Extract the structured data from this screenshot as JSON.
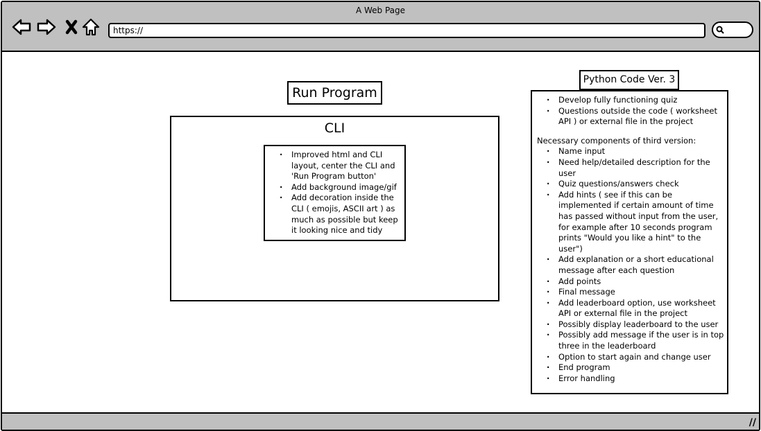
{
  "browser": {
    "title": "A Web Page",
    "url": "https://",
    "icons": [
      "back-arrow-icon",
      "forward-arrow-icon",
      "close-x-icon",
      "home-icon",
      "search-icon",
      "resize-handle-icon"
    ]
  },
  "main": {
    "run_button": "Run Program",
    "cli": {
      "title": "CLI",
      "notes": [
        "Improved html and CLI layout, center the CLI and 'Run Program button'",
        "Add background image/gif",
        "Add decoration inside the CLI ( emojis, ASCII art ) as much as possible but keep it looking nice and tidy"
      ]
    }
  },
  "python": {
    "title": "Python Code Ver. 3",
    "goals": [
      "Develop fully functioning quiz",
      "Questions outside the code ( worksheet API ) or external file in the project"
    ],
    "components_heading": "Necessary components of third version:",
    "components": [
      "Name input",
      "Need help/detailed description for the user",
      "Quiz questions/answers check",
      "Add hints ( see if this can be implemented if certain amount of time has passed without input from the user, for example after 10 seconds program prints \"Would you like a hint\" to the user\")",
      "Add explanation or a short educational message after each question",
      "Add points",
      "Final message",
      "Add leaderboard option, use worksheet API or external file in the project",
      "Possibly display leaderboard to the user",
      "Possibly add message if the user is in top three in the leaderboard",
      "Option to start again and change user",
      "End program",
      "Error handling"
    ]
  }
}
